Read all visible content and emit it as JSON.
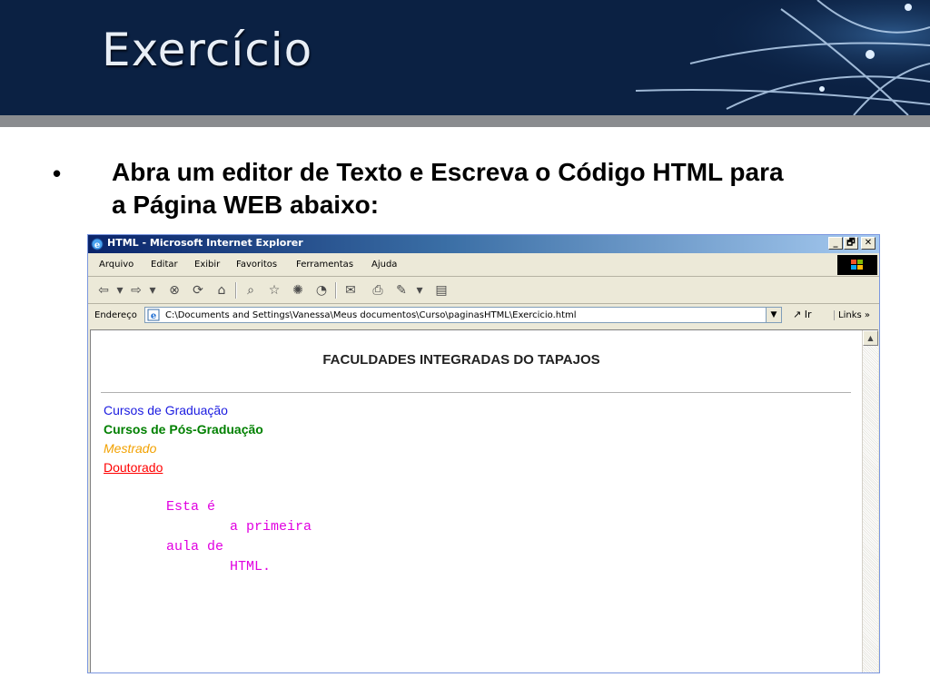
{
  "slide": {
    "title": "Exercício",
    "bullet_symbol": "•",
    "bullet_text": "Abra um editor de Texto e Escreva o Código HTML para a Página WEB abaixo:"
  },
  "browser": {
    "window_title": "HTML - Microsoft Internet Explorer",
    "window_buttons": {
      "minimize": "_",
      "restore": "🗗",
      "close": "✕"
    },
    "menu": [
      "Arquivo",
      "Editar",
      "Exibir",
      "Favoritos",
      "Ferramentas",
      "Ajuda"
    ],
    "toolbar_icons": [
      "back-arrow-icon",
      "forward-arrow-icon",
      "stop-icon",
      "refresh-icon",
      "home-icon",
      "search-icon",
      "favorites-icon",
      "media-icon",
      "history-icon",
      "mail-icon",
      "print-icon",
      "edit-icon",
      "discuss-icon"
    ],
    "address": {
      "label": "Endereço",
      "value": "C:\\Documents and Settings\\Vanessa\\Meus documentos\\Curso\\paginasHTML\\Exercicio.html",
      "go_label": "Ir",
      "links_label": "Links »"
    }
  },
  "document": {
    "heading": "FACULDADES INTEGRADAS DO TAPAJOS",
    "links": [
      {
        "text": "Cursos de Graduação",
        "color": "#1b1be0"
      },
      {
        "text": "Cursos de Pós-Graduação",
        "color": "#008000"
      },
      {
        "text": "Mestrado",
        "color": "#f2a100"
      },
      {
        "text": "Doutorado",
        "color": "#ff0000"
      }
    ],
    "pre_lines": [
      "Esta é",
      "a primeira",
      "aula de",
      "HTML."
    ],
    "pre_color": "#e100e1"
  }
}
